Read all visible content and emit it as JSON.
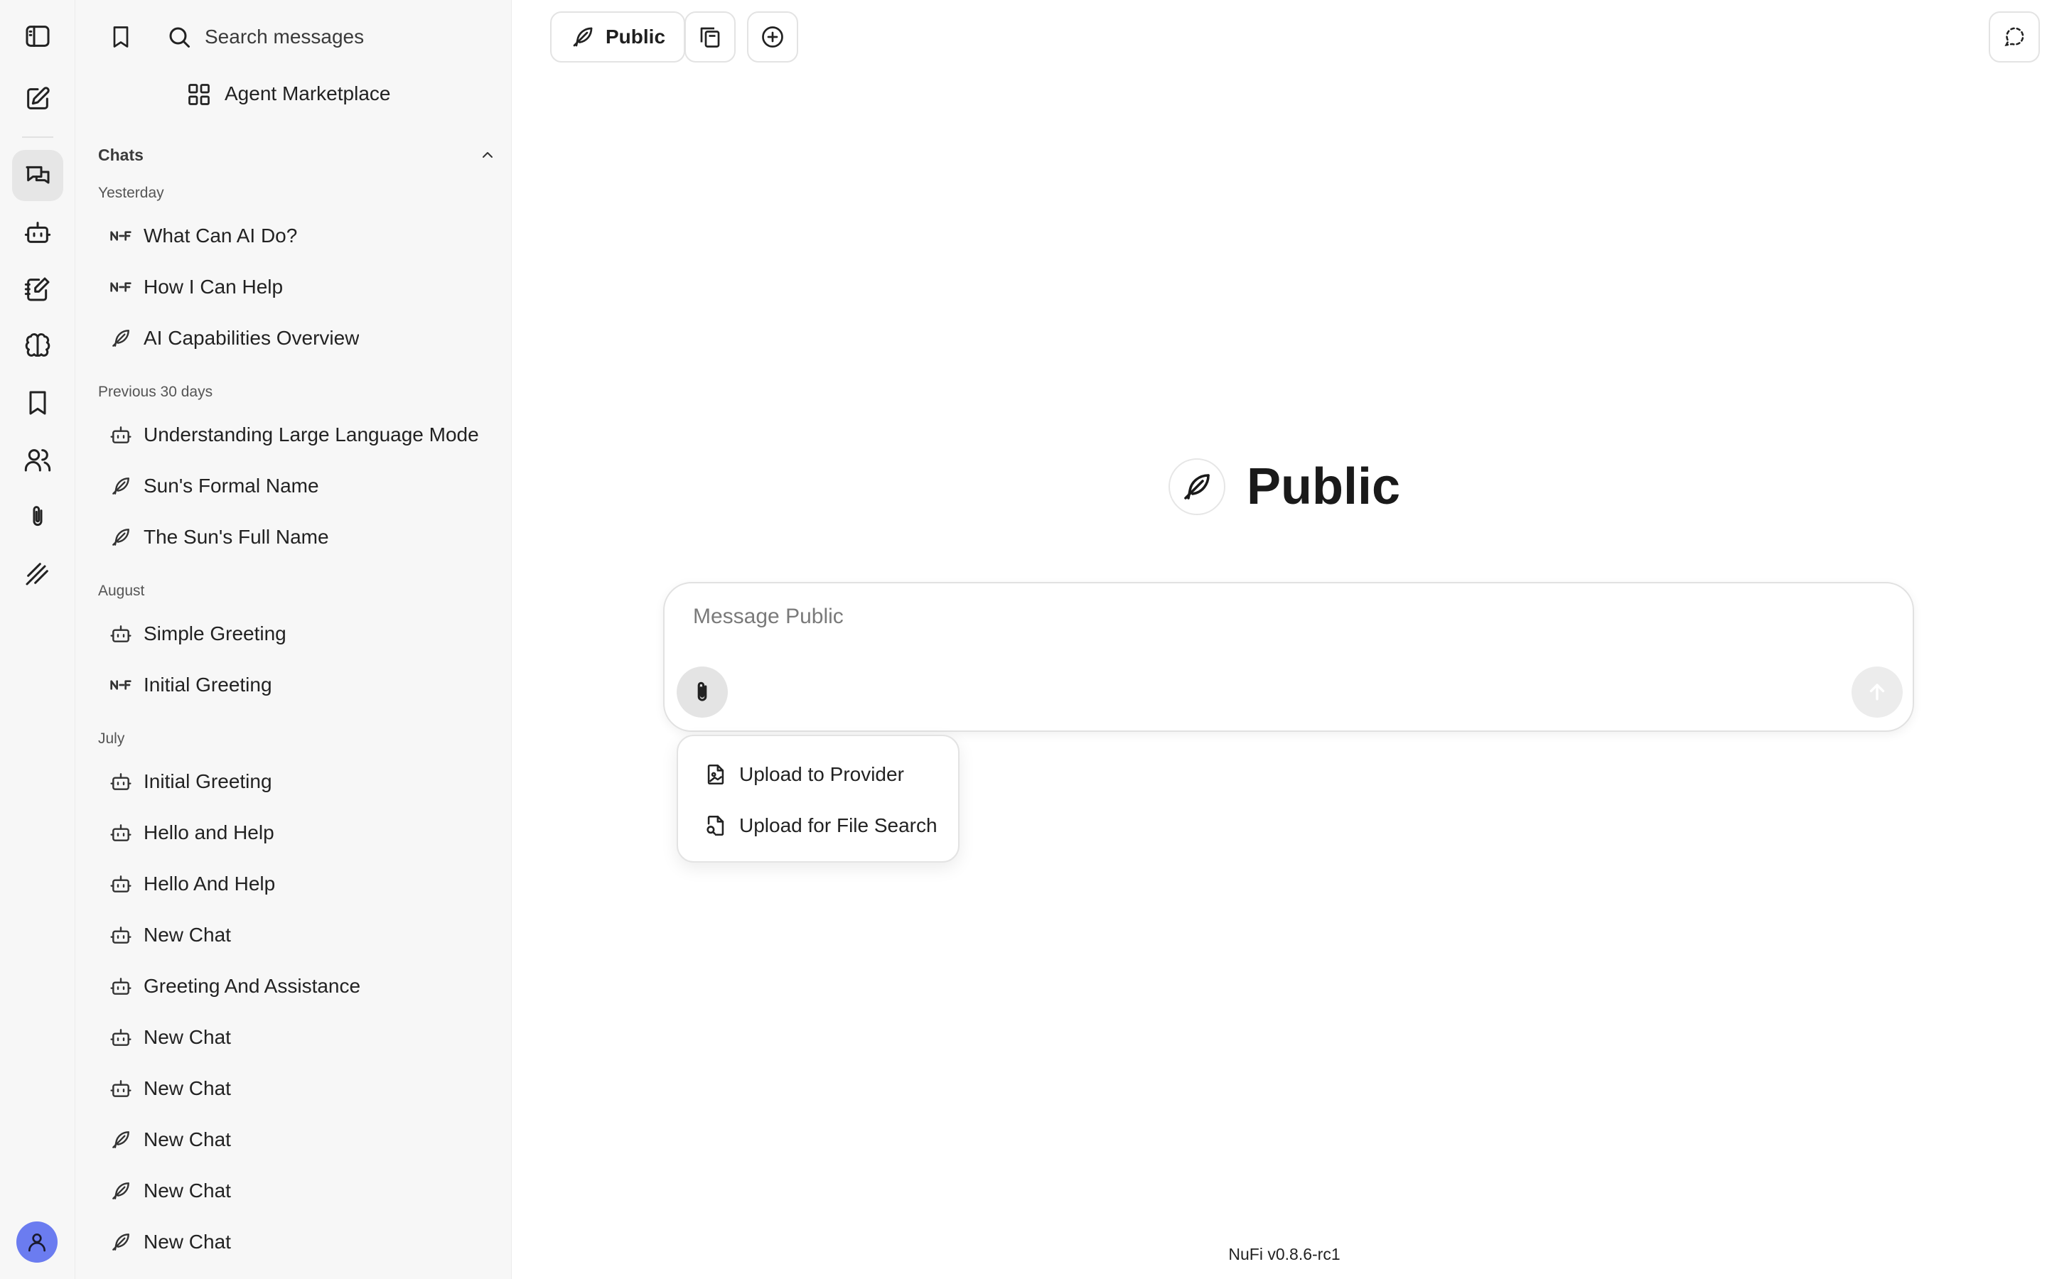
{
  "rail": {
    "items": [
      {
        "icon": "sidebar-toggle-icon"
      },
      {
        "icon": "new-chat-icon"
      },
      {
        "icon": "chats-icon",
        "active": true
      },
      {
        "icon": "agents-bot-icon"
      },
      {
        "icon": "prompts-icon"
      },
      {
        "icon": "memory-brain-icon"
      },
      {
        "icon": "bookmark-icon"
      },
      {
        "icon": "users-icon"
      },
      {
        "icon": "attachments-icon"
      },
      {
        "icon": "plugins-icon"
      }
    ],
    "avatar_color": "#6b7cf0"
  },
  "sidebar": {
    "search_placeholder": "Search messages",
    "marketplace_label": "Agent Marketplace",
    "chats_header": "Chats",
    "groups": [
      {
        "label": "Yesterday",
        "items": [
          {
            "label": "What Can AI Do?",
            "icon": "nufi-icon"
          },
          {
            "label": "How I Can Help",
            "icon": "nufi-icon"
          },
          {
            "label": "AI Capabilities Overview",
            "icon": "feather-icon"
          }
        ]
      },
      {
        "label": "Previous 30 days",
        "items": [
          {
            "label": "Understanding Large Language Mode",
            "icon": "bot-icon"
          },
          {
            "label": "Sun's Formal Name",
            "icon": "feather-icon"
          },
          {
            "label": "The Sun's Full Name",
            "icon": "feather-icon"
          }
        ]
      },
      {
        "label": "August",
        "items": [
          {
            "label": "Simple Greeting",
            "icon": "bot-icon"
          },
          {
            "label": "Initial Greeting",
            "icon": "nufi-icon"
          }
        ]
      },
      {
        "label": "July",
        "items": [
          {
            "label": "Initial Greeting",
            "icon": "bot-icon"
          },
          {
            "label": "Hello and Help",
            "icon": "bot-icon"
          },
          {
            "label": "Hello And Help",
            "icon": "bot-icon"
          },
          {
            "label": "New Chat",
            "icon": "bot-icon"
          },
          {
            "label": "Greeting And Assistance",
            "icon": "bot-icon"
          },
          {
            "label": "New Chat",
            "icon": "bot-icon"
          },
          {
            "label": "New Chat",
            "icon": "bot-icon"
          },
          {
            "label": "New Chat",
            "icon": "feather-icon"
          },
          {
            "label": "New Chat",
            "icon": "feather-icon"
          },
          {
            "label": "New Chat",
            "icon": "feather-icon"
          }
        ]
      }
    ]
  },
  "toolbar": {
    "endpoint_label": "Public"
  },
  "hero": {
    "title": "Public"
  },
  "composer": {
    "placeholder": "Message Public"
  },
  "attach_menu": {
    "items": [
      {
        "label": "Upload to Provider",
        "icon": "file-image-icon"
      },
      {
        "label": "Upload for File Search",
        "icon": "file-search-icon"
      }
    ]
  },
  "footer": {
    "version": "NuFi v0.8.6-rc1"
  }
}
